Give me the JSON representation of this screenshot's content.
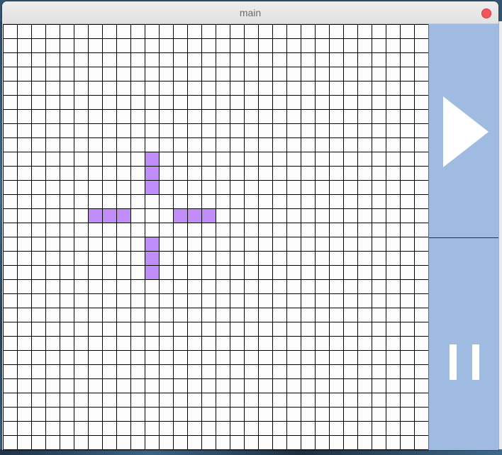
{
  "window": {
    "title": "main"
  },
  "grid": {
    "rows": 30,
    "cols": 30,
    "cell_color": "#fcfcfc",
    "line_color": "#000000",
    "alive_color": "#c08cfa",
    "alive_cells": [
      [
        9,
        10
      ],
      [
        10,
        10
      ],
      [
        11,
        10
      ],
      [
        13,
        6
      ],
      [
        13,
        7
      ],
      [
        13,
        8
      ],
      [
        13,
        12
      ],
      [
        13,
        13
      ],
      [
        13,
        14
      ],
      [
        15,
        10
      ],
      [
        16,
        10
      ],
      [
        17,
        10
      ]
    ]
  },
  "controls": {
    "panel_color": "#9fbbe2",
    "play_icon": "play-icon",
    "pause_icon": "pause-icon"
  }
}
